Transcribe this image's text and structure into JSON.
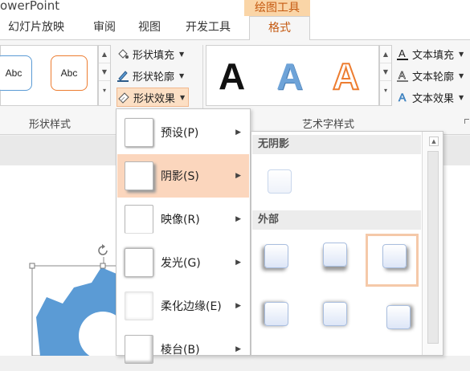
{
  "app": {
    "title": "owerPoint"
  },
  "context_tab": {
    "label": "绘图工具",
    "color": "#c55a11"
  },
  "tabs": [
    {
      "label": "幻灯片放映"
    },
    {
      "label": "审阅"
    },
    {
      "label": "视图"
    },
    {
      "label": "开发工具"
    },
    {
      "label": "格式",
      "active": true
    }
  ],
  "shape_styles": {
    "group_label": "形状样式",
    "thumbs": [
      {
        "label": "Abc",
        "border": "#5b9bd5"
      },
      {
        "label": "Abc",
        "border": "#ed7d31"
      }
    ],
    "commands": [
      {
        "label": "形状填充",
        "icon": "paint-bucket-icon"
      },
      {
        "label": "形状轮廓",
        "icon": "pen-outline-icon"
      },
      {
        "label": "形状效果",
        "icon": "shape-effects-icon"
      }
    ]
  },
  "wordart_styles": {
    "group_label": "艺术字样式",
    "samples": [
      {
        "label": "A",
        "style": "black"
      },
      {
        "label": "A",
        "style": "blue-gradient"
      },
      {
        "label": "A",
        "style": "orange-outline"
      }
    ],
    "commands": [
      {
        "label": "文本填充",
        "icon": "text-fill-icon"
      },
      {
        "label": "文本轮廓",
        "icon": "text-outline-icon"
      },
      {
        "label": "文本效果",
        "icon": "text-effects-icon"
      }
    ]
  },
  "effects_menu": {
    "items": [
      {
        "label": "预设(P)"
      },
      {
        "label": "阴影(S)",
        "active": true
      },
      {
        "label": "映像(R)"
      },
      {
        "label": "发光(G)"
      },
      {
        "label": "柔化边缘(E)"
      },
      {
        "label": "棱台(B)"
      }
    ]
  },
  "shadow_submenu": {
    "no_shadow_header": "无阴影",
    "outer_header": "外部"
  }
}
